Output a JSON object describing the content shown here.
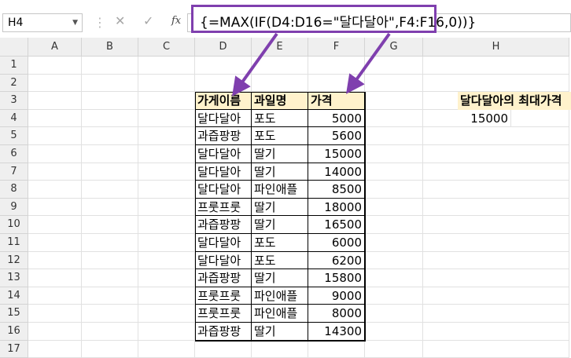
{
  "formula_bar": {
    "name_box": "H4",
    "cancel_icon": "✕",
    "enter_icon": "✓",
    "fx_label": "fx",
    "formula": "{=MAX(IF(D4:D16=\"달다달아\",F4:F16,0))}"
  },
  "columns": [
    "A",
    "B",
    "C",
    "D",
    "E",
    "F",
    "G",
    "H"
  ],
  "rows": [
    "1",
    "2",
    "3",
    "4",
    "5",
    "6",
    "7",
    "8",
    "9",
    "10",
    "11",
    "12",
    "13",
    "14",
    "15",
    "16",
    "17"
  ],
  "table": {
    "headers": [
      "가게이름",
      "과일명",
      "가격"
    ],
    "rows": [
      [
        "달다달아",
        "포도",
        "5000"
      ],
      [
        "과즙팡팡",
        "포도",
        "5600"
      ],
      [
        "달다달아",
        "딸기",
        "15000"
      ],
      [
        "달다달아",
        "딸기",
        "14000"
      ],
      [
        "달다달아",
        "파인애플",
        "8500"
      ],
      [
        "프룻프룻",
        "딸기",
        "18000"
      ],
      [
        "과즙팡팡",
        "딸기",
        "16500"
      ],
      [
        "달다달아",
        "포도",
        "6000"
      ],
      [
        "달다달아",
        "포도",
        "6200"
      ],
      [
        "과즙팡팡",
        "딸기",
        "15800"
      ],
      [
        "프룻프룻",
        "파인애플",
        "9000"
      ],
      [
        "프룻프룻",
        "파인애플",
        "8000"
      ],
      [
        "과즙팡팡",
        "딸기",
        "14300"
      ]
    ]
  },
  "result": {
    "label": "달다달아의 최대가격",
    "value": "15000"
  },
  "colors": {
    "highlight": "#fff2cc",
    "annotation": "#7f3fae"
  }
}
